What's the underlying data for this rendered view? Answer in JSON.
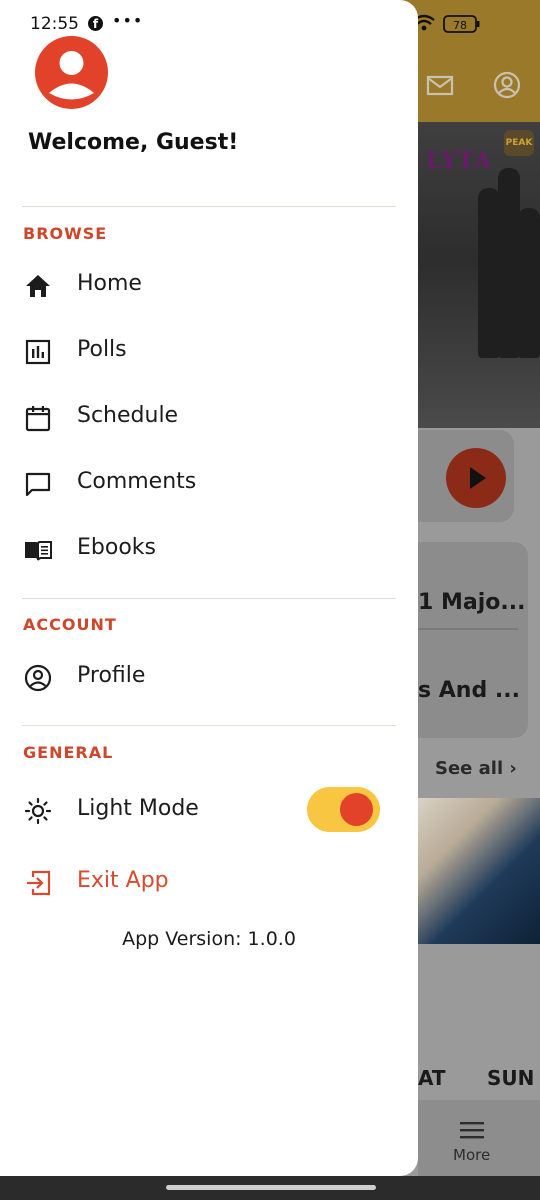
{
  "status_bar": {
    "time": "12:55",
    "battery": "78"
  },
  "drawer": {
    "welcome": "Welcome, Guest!",
    "sections": {
      "browse": "BROWSE",
      "account": "ACCOUNT",
      "general": "GENERAL"
    },
    "items": {
      "home": "Home",
      "polls": "Polls",
      "schedule": "Schedule",
      "comments": "Comments",
      "ebooks": "Ebooks",
      "profile": "Profile",
      "light_mode": "Light Mode",
      "exit_app": "Exit App"
    },
    "light_mode_on": true,
    "version": "App Version: 1.0.0"
  },
  "background": {
    "hero_text": "LYTA",
    "hero_badge": "PEAK",
    "card_title_1": "1 Majo...",
    "card_title_2": "s And ...",
    "see_all": "See all ›",
    "day_sat": "AT",
    "day_sun": "SUN",
    "tab_more": "More"
  },
  "colors": {
    "accent": "#d0462b",
    "toggle_track": "#f8c640",
    "toggle_knob": "#e2412a",
    "avatar": "#e2412a"
  }
}
